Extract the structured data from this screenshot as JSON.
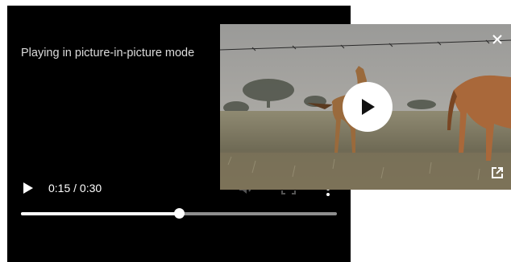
{
  "player": {
    "pip_message": "Playing in picture-in-picture mode",
    "time_display": "0:15 / 0:30",
    "progress_fraction": 0.5,
    "icons": {
      "play": "play-icon",
      "mute": "volume-icon",
      "fullscreen": "fullscreen-icon",
      "more": "more-options-icon"
    }
  },
  "pip_window": {
    "icons": {
      "close": "close-icon",
      "center_play": "play-icon",
      "back_to_tab": "back-to-tab-icon"
    }
  },
  "colors": {
    "player_bg": "#000000",
    "progress_fill": "#ffffff",
    "progress_track": "#8e8e8e"
  }
}
